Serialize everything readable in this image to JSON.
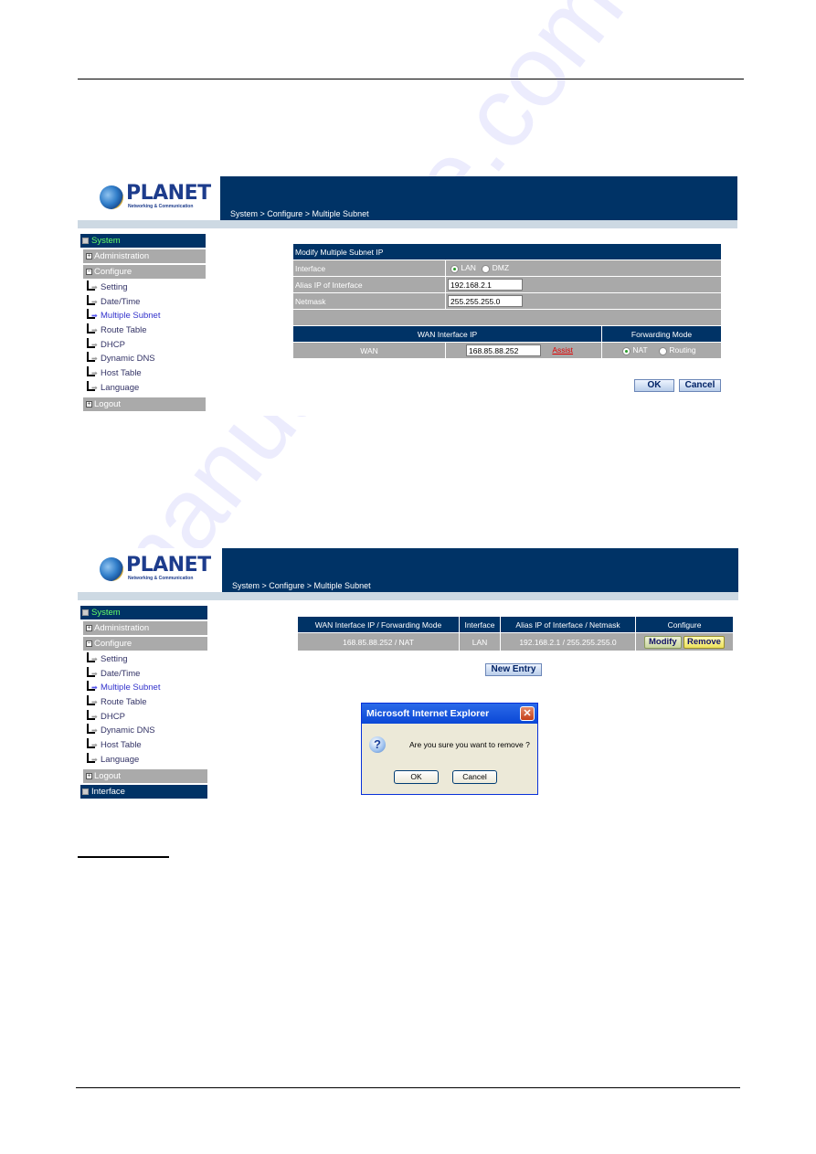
{
  "watermark": "manualshive.com",
  "screenshot1": {
    "logo": {
      "name": "PLANET",
      "tagline": "Networking & Communication"
    },
    "breadcrumb": "System > Configure > Multiple Subnet",
    "sidebar": {
      "head": "System",
      "groups": [
        {
          "label": "Administration"
        },
        {
          "label": "Configure"
        }
      ],
      "items": [
        {
          "label": "Setting"
        },
        {
          "label": "Date/Time"
        },
        {
          "label": "Multiple Subnet",
          "active": true
        },
        {
          "label": "Route Table"
        },
        {
          "label": "DHCP"
        },
        {
          "label": "Dynamic DNS"
        },
        {
          "label": "Host Table"
        },
        {
          "label": "Language"
        }
      ],
      "logout": "Logout"
    },
    "form": {
      "title": "Modify Multiple Subnet IP",
      "interface_label": "Interface",
      "interface_options": [
        "LAN",
        "DMZ"
      ],
      "interface_selected": "LAN",
      "alias_label": "Alias IP of Interface",
      "alias_value": "192.168.2.1",
      "netmask_label": "Netmask",
      "netmask_value": "255.255.255.0",
      "wan_header": "WAN Interface IP",
      "mode_header": "Forwarding Mode",
      "wan_label": "WAN",
      "wan_value": "168.85.88.252",
      "assist_link": "Assist",
      "mode_options": [
        "NAT",
        "Routing"
      ],
      "mode_selected": "NAT",
      "ok": "OK",
      "cancel": "Cancel"
    }
  },
  "screenshot2": {
    "logo": {
      "name": "PLANET",
      "tagline": "Networking & Communication"
    },
    "breadcrumb": "System > Configure > Multiple Subnet",
    "sidebar": {
      "head": "System",
      "groups": [
        {
          "label": "Administration"
        },
        {
          "label": "Configure"
        }
      ],
      "items": [
        {
          "label": "Setting"
        },
        {
          "label": "Date/Time"
        },
        {
          "label": "Multiple Subnet",
          "active": true
        },
        {
          "label": "Route Table"
        },
        {
          "label": "DHCP"
        },
        {
          "label": "Dynamic DNS"
        },
        {
          "label": "Host Table"
        },
        {
          "label": "Language"
        }
      ],
      "logout": "Logout",
      "interface": "Interface"
    },
    "table": {
      "headers": [
        "WAN Interface IP / Forwarding Mode",
        "Interface",
        "Alias IP of Interface / Netmask",
        "Configure"
      ],
      "rows": [
        {
          "wan": "168.85.88.252 / NAT",
          "interface": "LAN",
          "alias": "192.168.2.1 / 255.255.255.0",
          "modify": "Modify",
          "remove": "Remove"
        }
      ]
    },
    "new_entry": "New Entry",
    "dialog": {
      "title": "Microsoft Internet Explorer",
      "message": "Are you sure you want to remove ?",
      "ok": "OK",
      "cancel": "Cancel"
    }
  }
}
